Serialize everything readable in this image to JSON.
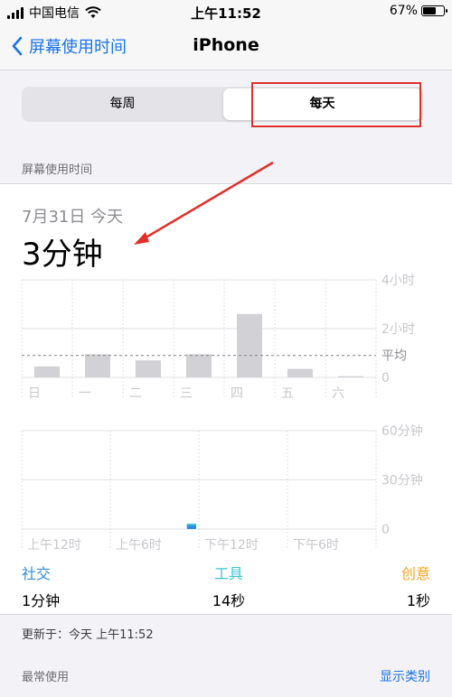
{
  "status_bar": {
    "carrier": "中国电信",
    "time": "上午11:52",
    "battery": "67%",
    "battery_level": 0.67
  },
  "nav": {
    "back_label": "屏幕使用时间",
    "title": "iPhone"
  },
  "segments": {
    "week": "每周",
    "day": "每天"
  },
  "section_header": "屏幕使用时间",
  "summary": {
    "date": "7月31日 今天",
    "total": "3分钟"
  },
  "chart_data": [
    {
      "type": "bar",
      "categories": [
        "日",
        "一",
        "二",
        "三",
        "四",
        "五",
        "六"
      ],
      "values": [
        0.45,
        0.95,
        0.7,
        0.95,
        2.6,
        0.35,
        0.05
      ],
      "ylim": [
        0,
        4
      ],
      "y_ticks": [
        {
          "value": 4,
          "label": "4小时"
        },
        {
          "value": 2,
          "label": "2小时"
        },
        {
          "value": 0,
          "label": "0"
        }
      ],
      "average": {
        "value": 0.9,
        "label": "平均"
      },
      "grid": true
    },
    {
      "type": "bar",
      "categories": [
        "上午12时",
        "上午6时",
        "下午12时",
        "下午6时"
      ],
      "bins": 24,
      "values": [
        0,
        0,
        0,
        0,
        0,
        0,
        0,
        0,
        0,
        0,
        0,
        3,
        0,
        0,
        0,
        0,
        0,
        0,
        0,
        0,
        0,
        0,
        0,
        0
      ],
      "ylim": [
        0,
        60
      ],
      "y_ticks": [
        {
          "value": 60,
          "label": "60分钟"
        },
        {
          "value": 30,
          "label": "30分钟"
        },
        {
          "value": 0,
          "label": "0"
        }
      ],
      "grid": true
    }
  ],
  "categories": [
    {
      "name": "社交",
      "value": "1分钟",
      "color": "#2f8fd8"
    },
    {
      "name": "工具",
      "value": "14秒",
      "color": "#3cc4d6"
    },
    {
      "name": "创意",
      "value": "1秒",
      "color": "#f5a623"
    }
  ],
  "updated": "更新于：今天 上午11:52",
  "most_used": "最常使用",
  "show_categories": "显示类别",
  "colors": {
    "accent": "#1a73e8",
    "bar": "#d1d1d6",
    "annotation": "#e0302a"
  }
}
